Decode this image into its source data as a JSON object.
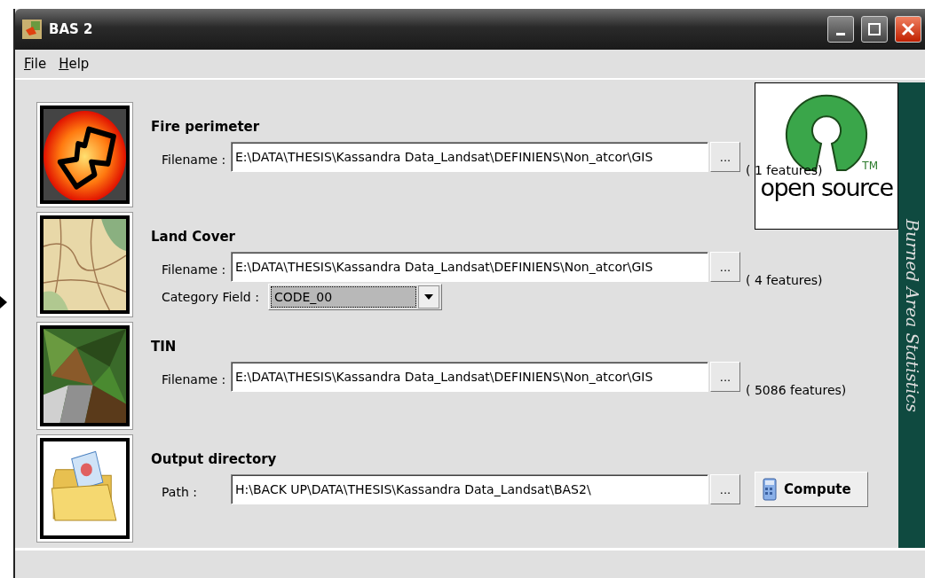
{
  "window": {
    "title": "BAS 2"
  },
  "menu": [
    "File",
    "Help"
  ],
  "sections": [
    {
      "kind": "file",
      "title": "Fire perimeter",
      "label": "Filename :",
      "value": "E:\\DATA\\THESIS\\Kassandra Data_Landsat\\DEFINIENS\\Non_atcor\\GIS",
      "browse": "...",
      "count": "( 1 features)"
    },
    {
      "kind": "file",
      "title": "Land Cover",
      "label": "Filename :",
      "value": "E:\\DATA\\THESIS\\Kassandra Data_Landsat\\DEFINIENS\\Non_atcor\\GIS",
      "browse": "...",
      "count": "( 4 features)",
      "category": {
        "label": "Category Field :",
        "value": "CODE_00"
      }
    },
    {
      "kind": "file",
      "title": "TIN",
      "label": "Filename :",
      "value": "E:\\DATA\\THESIS\\Kassandra Data_Landsat\\DEFINIENS\\Non_atcor\\GIS",
      "browse": "...",
      "count": "( 5086 features)"
    },
    {
      "kind": "output",
      "title": "Output directory",
      "label": "Path :",
      "value": "H:\\BACK UP\\DATA\\THESIS\\Kassandra Data_Landsat\\BAS2\\",
      "browse": "...",
      "action": "Compute"
    }
  ],
  "logo": {
    "text": "open source",
    "tm": "TM"
  },
  "banner": "Burned Area Statistics"
}
